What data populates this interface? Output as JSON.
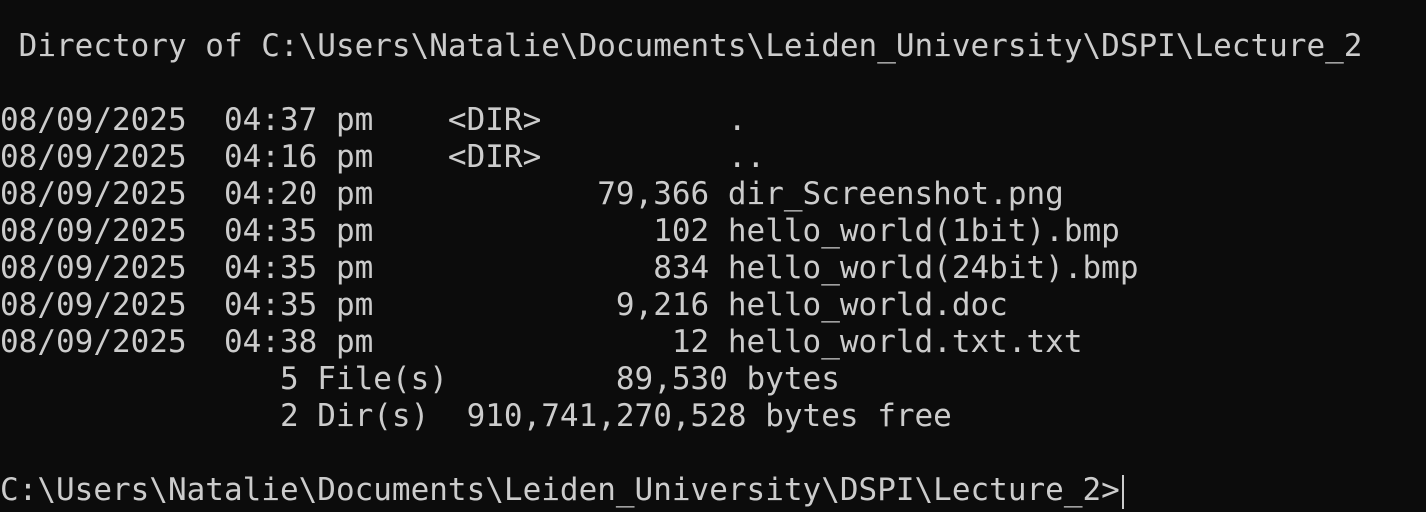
{
  "header": {
    "directory_line": " Directory of C:\\Users\\Natalie\\Documents\\Leiden_University\\DSPI\\Lecture_2"
  },
  "entries": [
    "08/09/2025  04:37 pm    <DIR>          .",
    "08/09/2025  04:16 pm    <DIR>          ..",
    "08/09/2025  04:20 pm            79,366 dir_Screenshot.png",
    "08/09/2025  04:35 pm               102 hello_world(1bit).bmp",
    "08/09/2025  04:35 pm               834 hello_world(24bit).bmp",
    "08/09/2025  04:35 pm             9,216 hello_world.doc",
    "08/09/2025  04:38 pm                12 hello_world.txt.txt"
  ],
  "summary": {
    "files_line": "               5 File(s)         89,530 bytes",
    "dirs_line": "               2 Dir(s)  910,741,270,528 bytes free"
  },
  "prompt": {
    "text": "C:\\Users\\Natalie\\Documents\\Leiden_University\\DSPI\\Lecture_2>"
  },
  "colors": {
    "background": "#0c0c0c",
    "foreground": "#cccccc"
  }
}
